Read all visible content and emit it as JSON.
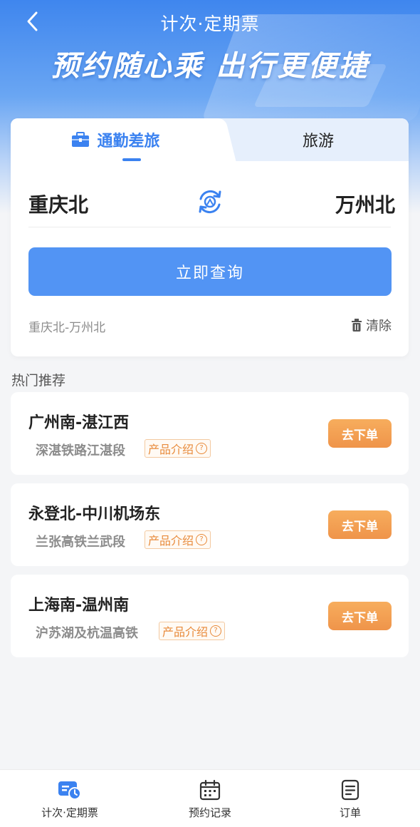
{
  "header": {
    "title": "计次·定期票",
    "slogan": "预约随心乘 出行更便捷"
  },
  "booking": {
    "tabs": [
      {
        "label": "通勤差旅",
        "active": true
      },
      {
        "label": "旅游",
        "active": false
      }
    ],
    "from_station": "重庆北",
    "to_station": "万州北",
    "query_button": "立即查询",
    "history": "重庆北-万州北",
    "clear_label": "清除"
  },
  "recommend": {
    "title": "热门推荐",
    "intro_label": "产品介绍",
    "order_label": "去下单",
    "routes": [
      {
        "route": "广州南-湛江西",
        "line": "深湛铁路江湛段"
      },
      {
        "route": "永登北-中川机场东",
        "line": "兰张高铁兰武段"
      },
      {
        "route": "上海南-温州南",
        "line": "沪苏湖及杭温高铁"
      }
    ]
  },
  "bottom_nav": [
    {
      "label": "计次·定期票",
      "icon": "ticket-clock-icon",
      "active": true
    },
    {
      "label": "预约记录",
      "icon": "calendar-icon",
      "active": false
    },
    {
      "label": "订单",
      "icon": "order-list-icon",
      "active": false
    }
  ],
  "colors": {
    "primary": "#3b82f0",
    "button_blue": "#5294f4",
    "order_orange": "#f0964a",
    "tag_orange": "#e88a3a"
  }
}
